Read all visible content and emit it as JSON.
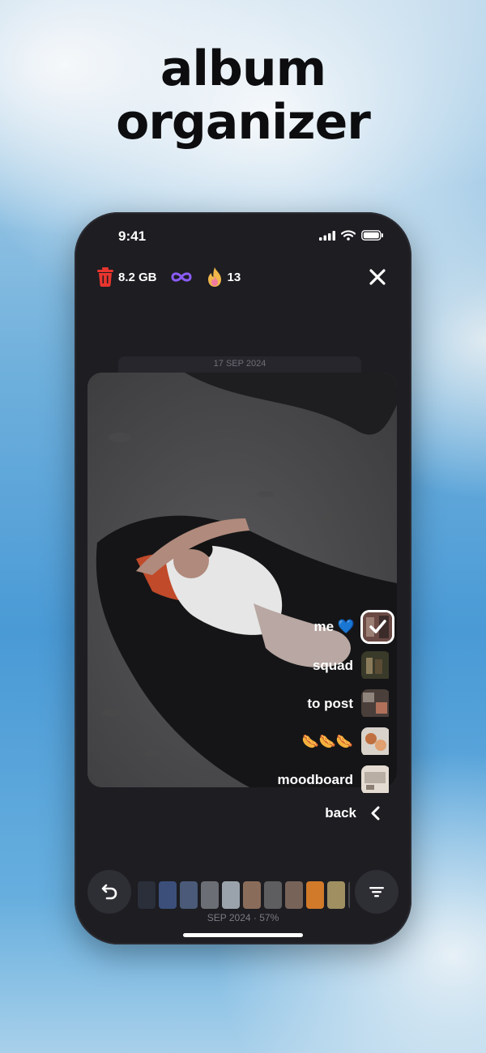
{
  "headline": {
    "line1": "album",
    "line2": "organizer"
  },
  "status_bar": {
    "time": "9:41"
  },
  "stats": {
    "trash_size": "8.2 GB",
    "streak": "13"
  },
  "photo": {
    "date": "17 SEP 2024"
  },
  "albums": [
    {
      "label": "me 💙",
      "selected": true
    },
    {
      "label": "squad",
      "selected": false
    },
    {
      "label": "to post",
      "selected": false
    },
    {
      "label": "🌭🌭🌭",
      "selected": false
    },
    {
      "label": "moodboard",
      "selected": false
    }
  ],
  "back_label": "back",
  "footer": {
    "progress": "SEP 2024 · 57%"
  },
  "icons": {
    "trash": "trash-icon",
    "infinity": "infinity-icon",
    "flame": "flame-icon",
    "close": "close-icon",
    "undo": "undo-icon",
    "filter": "filter-icon",
    "chevron": "chevron-left-icon"
  },
  "colors": {
    "trash": "#e8352e",
    "infinity": "#8b5cf6",
    "flame": "#f0b64a"
  }
}
